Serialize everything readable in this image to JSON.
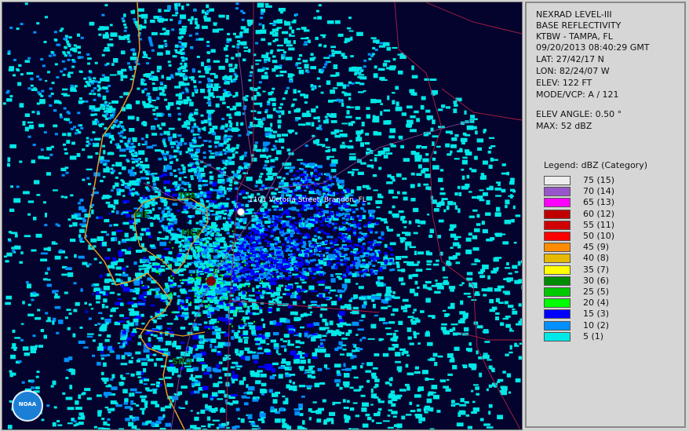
{
  "info": {
    "line1": "NEXRAD LEVEL-III",
    "line2": "BASE REFLECTIVITY",
    "station": "KTBW - TAMPA, FL",
    "datetime": "09/20/2013 08:40:29 GMT",
    "lat": "LAT: 27/42/17 N",
    "lon": "LON: 82/24/07 W",
    "elev": "ELEV: 122 FT",
    "mode": "MODE/VCP: A / 121",
    "elev_angle": "ELEV ANGLE: 0.50 °",
    "max": "MAX: 52 dBZ"
  },
  "legend": {
    "title": "Legend: dBZ (Category)",
    "items": [
      {
        "label": "75  (15)",
        "color": "#eeeeee"
      },
      {
        "label": "70  (14)",
        "color": "#9955cc"
      },
      {
        "label": "65  (13)",
        "color": "#ff00ff"
      },
      {
        "label": "60  (12)",
        "color": "#c00000"
      },
      {
        "label": "55  (11)",
        "color": "#d00000"
      },
      {
        "label": "50  (10)",
        "color": "#ff0000"
      },
      {
        "label": "45  (9)",
        "color": "#ff8c00"
      },
      {
        "label": "40  (8)",
        "color": "#e6b800"
      },
      {
        "label": "35  (7)",
        "color": "#ffff00"
      },
      {
        "label": "30  (6)",
        "color": "#008c00"
      },
      {
        "label": "25  (5)",
        "color": "#00c800"
      },
      {
        "label": "20  (4)",
        "color": "#00ff00"
      },
      {
        "label": "15  (3)",
        "color": "#0000ff"
      },
      {
        "label": "10  (2)",
        "color": "#0090ff"
      },
      {
        "label": "5  (1)",
        "color": "#00e8e8"
      }
    ]
  },
  "map": {
    "places": [
      {
        "label": "TPA"
      },
      {
        "label": "PIE"
      },
      {
        "label": "MCF"
      },
      {
        "label": "SRQ"
      }
    ],
    "address": "1101 Victoria Street, Brandon, FL",
    "logo_text": "NOAA",
    "colors": {
      "background": "#03032e",
      "coast": "#e0a020",
      "county": "#b02040",
      "road": "#8a4a8a"
    }
  }
}
